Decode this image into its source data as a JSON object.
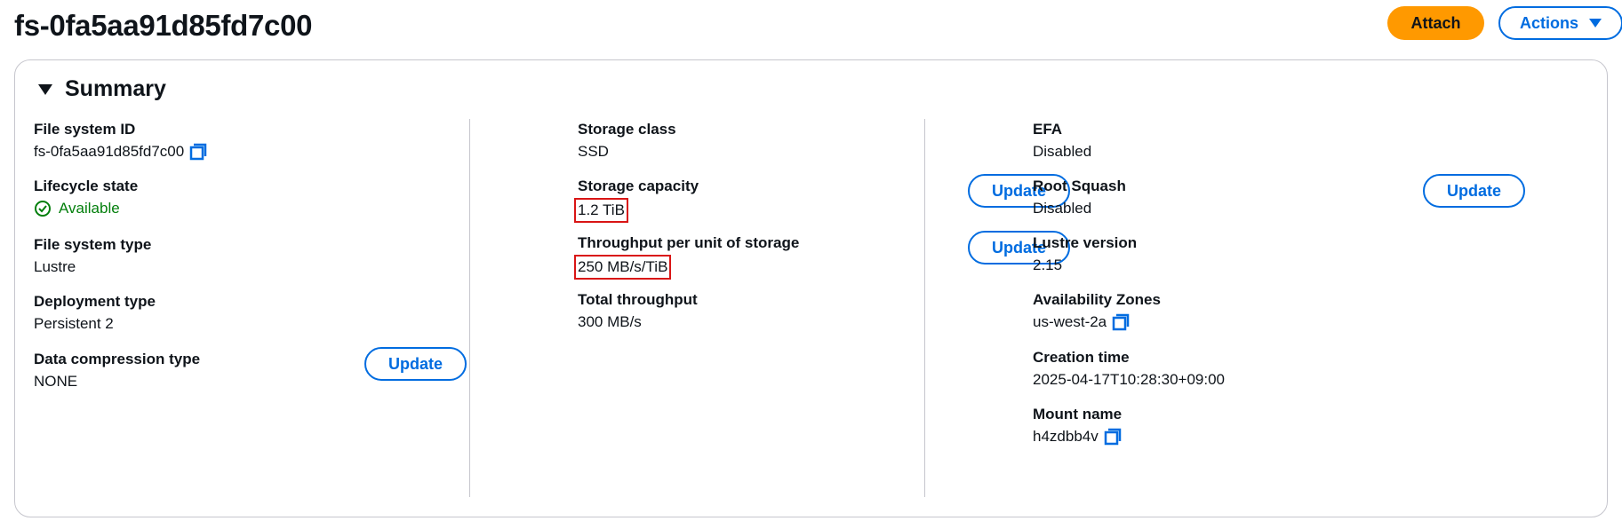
{
  "header": {
    "title": "fs-0fa5aa91d85fd7c00",
    "attach_label": "Attach",
    "actions_label": "Actions"
  },
  "summary": {
    "title": "Summary",
    "update_label": "Update",
    "col1": {
      "file_system_id": {
        "label": "File system ID",
        "value": "fs-0fa5aa91d85fd7c00"
      },
      "lifecycle_state": {
        "label": "Lifecycle state",
        "value": "Available"
      },
      "file_system_type": {
        "label": "File system type",
        "value": "Lustre"
      },
      "deployment_type": {
        "label": "Deployment type",
        "value": "Persistent 2"
      },
      "data_compression": {
        "label": "Data compression type",
        "value": "NONE"
      }
    },
    "col2": {
      "storage_class": {
        "label": "Storage class",
        "value": "SSD"
      },
      "storage_capacity": {
        "label": "Storage capacity",
        "value": "1.2 TiB"
      },
      "throughput_per_unit": {
        "label": "Throughput per unit of storage",
        "value": "250 MB/s/TiB"
      },
      "total_throughput": {
        "label": "Total throughput",
        "value": "300 MB/s"
      }
    },
    "col3": {
      "efa": {
        "label": "EFA",
        "value": "Disabled"
      },
      "root_squash": {
        "label": "Root Squash",
        "value": "Disabled"
      },
      "lustre_version": {
        "label": "Lustre version",
        "value": "2.15"
      },
      "availability_zones": {
        "label": "Availability Zones",
        "value": "us-west-2a"
      },
      "creation_time": {
        "label": "Creation time",
        "value": "2025-04-17T10:28:30+09:00"
      },
      "mount_name": {
        "label": "Mount name",
        "value": "h4zdbb4v"
      }
    }
  },
  "colors": {
    "accent": "#006ce0",
    "primary_button": "#ff9900",
    "success": "#037f0c",
    "highlight_box": "#d91515"
  },
  "icons": {
    "copy": "copy-icon",
    "status": "status-positive-icon",
    "caret": "caret-down-icon"
  }
}
